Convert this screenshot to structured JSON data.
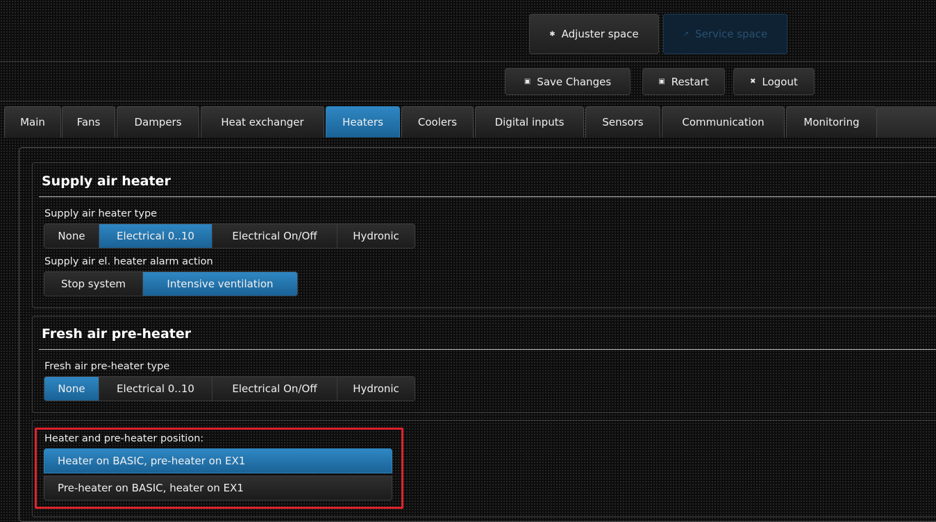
{
  "header": {
    "adjuster_label": "Adjuster space",
    "service_label": "Service space",
    "save_label": "Save Changes",
    "restart_label": "Restart",
    "logout_label": "Logout"
  },
  "tabs": [
    {
      "label": "Main",
      "active": false
    },
    {
      "label": "Fans",
      "active": false
    },
    {
      "label": "Dampers",
      "active": false
    },
    {
      "label": "Heat exchanger",
      "active": false
    },
    {
      "label": "Heaters",
      "active": true
    },
    {
      "label": "Coolers",
      "active": false
    },
    {
      "label": "Digital inputs",
      "active": false
    },
    {
      "label": "Sensors",
      "active": false
    },
    {
      "label": "Communication",
      "active": false
    },
    {
      "label": "Monitoring",
      "active": false
    }
  ],
  "supply": {
    "title": "Supply air heater",
    "type_label": "Supply air heater type",
    "type_options": [
      "None",
      "Electrical 0..10",
      "Electrical On/Off",
      "Hydronic"
    ],
    "type_selected": "Electrical 0..10",
    "alarm_label": "Supply air el. heater alarm action",
    "alarm_options": [
      "Stop system",
      "Intensive ventilation"
    ],
    "alarm_selected": "Intensive ventilation"
  },
  "fresh": {
    "title": "Fresh air pre-heater",
    "type_label": "Fresh air pre-heater type",
    "type_options": [
      "None",
      "Electrical 0..10",
      "Electrical On/Off",
      "Hydronic"
    ],
    "type_selected": "None"
  },
  "position": {
    "label": "Heater and pre-heater position:",
    "options": [
      "Heater on BASIC, pre-heater on EX1",
      "Pre-heater on BASIC, heater on EX1"
    ],
    "selected": "Heater on BASIC, pre-heater on EX1"
  },
  "icons": {
    "adjuster": "gear-icon",
    "service": "wrench-icon",
    "save": "save-icon",
    "restart": "restart-icon",
    "logout": "logout-icon"
  },
  "colors": {
    "accent": "#1f75b0",
    "highlight": "#e0222a"
  }
}
